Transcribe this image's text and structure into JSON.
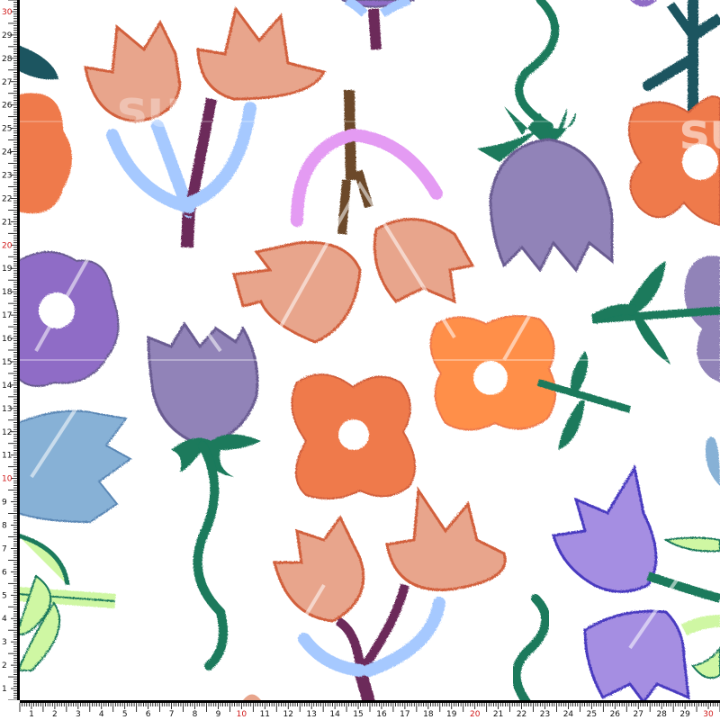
{
  "pattern": {
    "background": "#ffffff",
    "motifs": [
      "pink-tulip",
      "lavender-tulip",
      "orange-flower",
      "purple-flower",
      "blue-tulip",
      "leaf-sprig"
    ],
    "colors": {
      "peach": "#e8a58c",
      "peach_edge": "#d2613c",
      "lavender": "#9183b8",
      "lavender_dark": "#6a5c92",
      "orange": "#ef7a4c",
      "orange_light": "#ff8f4a",
      "purple": "#8f6cc6",
      "violet": "#a58ee2",
      "steel_blue": "#87b1d6",
      "sky_blue": "#a6c9ff",
      "pink_lilac": "#e49bf3",
      "teal_green": "#1a7a5c",
      "dark_teal": "#1d5560",
      "lime": "#cff7a3",
      "plum": "#6c2a5a"
    }
  },
  "watermark": {
    "text": "su",
    "color": "#ffffff"
  },
  "ruler": {
    "start": 1,
    "end": 30,
    "labels_y": [
      "30",
      "29",
      "28",
      "27",
      "26",
      "25",
      "24",
      "23",
      "22",
      "21",
      "20",
      "19",
      "18",
      "17",
      "16",
      "15",
      "14",
      "13",
      "12",
      "11",
      "10",
      "9",
      "8",
      "7",
      "6",
      "5",
      "4",
      "3",
      "2",
      "1"
    ],
    "labels_x": [
      "1",
      "2",
      "3",
      "4",
      "5",
      "6",
      "7",
      "8",
      "9",
      "10",
      "11",
      "12",
      "13",
      "14",
      "15",
      "16",
      "17",
      "18",
      "19",
      "20",
      "21",
      "22",
      "23",
      "24",
      "25",
      "26",
      "27",
      "28",
      "29",
      "30"
    ],
    "highlight": [
      "10",
      "20",
      "30"
    ],
    "bar_color": "#000000",
    "label_color": "#111111",
    "highlight_color": "#d01818"
  }
}
